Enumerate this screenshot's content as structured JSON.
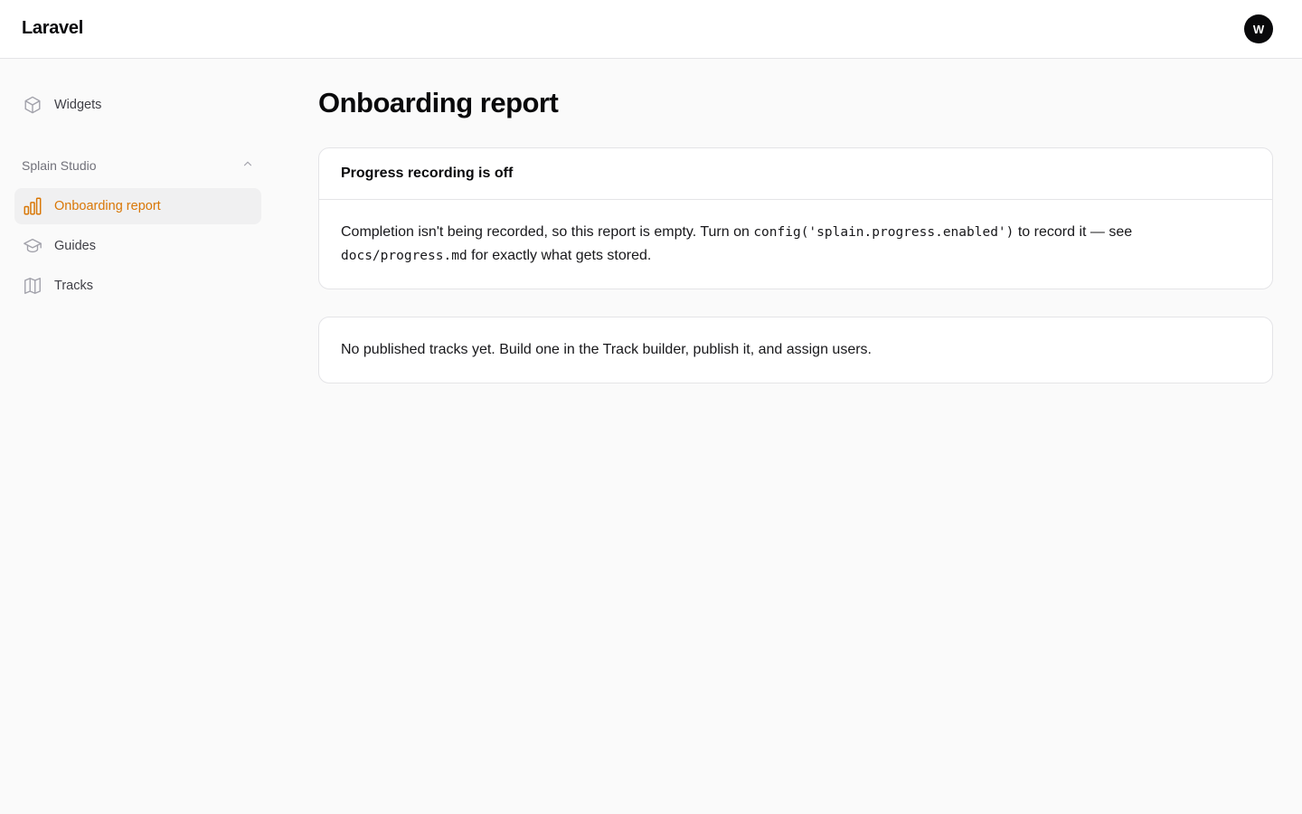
{
  "app": {
    "brand": "Laravel"
  },
  "user": {
    "avatar_initial": "W"
  },
  "sidebar": {
    "items": [
      {
        "label": "Widgets",
        "icon": "cube-icon"
      }
    ],
    "group": {
      "label": "Splain Studio",
      "expanded": true,
      "icon": "chevron-up-icon",
      "items": [
        {
          "label": "Onboarding report",
          "icon": "chart-bar-icon",
          "active": true
        },
        {
          "label": "Guides",
          "icon": "academic-cap-icon",
          "active": false
        },
        {
          "label": "Tracks",
          "icon": "map-icon",
          "active": false
        }
      ]
    }
  },
  "main": {
    "title": "Onboarding report",
    "notice": {
      "heading": "Progress recording is off",
      "text_1": "Completion isn't being recorded, so this report is empty. Turn on ",
      "code_1": "config('splain.progress.enabled')",
      "text_2": " to record it — see ",
      "code_2": "docs/progress.md",
      "text_3": " for exactly what gets stored."
    },
    "empty_state": "No published tracks yet. Build one in the Track builder, publish it, and assign users."
  },
  "colors": {
    "accent": "#d97706",
    "active_bg": "#f0f0f1",
    "page_bg": "#fafafa",
    "border": "#e4e4e7"
  }
}
